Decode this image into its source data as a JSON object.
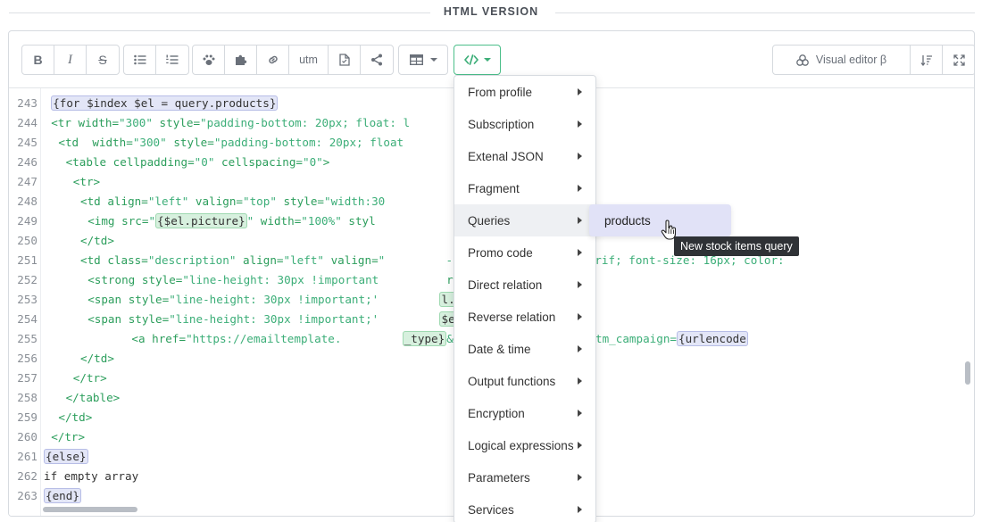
{
  "header": {
    "title": "HTML VERSION"
  },
  "toolbar": {
    "bold_label": "B",
    "italic_label": "I",
    "strike_label": "S",
    "utm_label": "utm",
    "visual_editor_label": "Visual editor β",
    "icons": [
      "bold-icon",
      "italic-icon",
      "strikethrough-icon",
      "bullet-list-icon",
      "numbered-list-icon",
      "paw-icon",
      "puzzle-icon",
      "link-icon",
      "utm-text",
      "document-icon",
      "share-icon",
      "table-icon",
      "code-icon",
      "sort-icon",
      "expand-icon"
    ]
  },
  "code_lines": [
    {
      "n": "243",
      "i": 1,
      "parts": [
        [
          "tpl",
          "{for $index $el = query.products}"
        ]
      ]
    },
    {
      "n": "244",
      "i": 1,
      "parts": [
        [
          "tag",
          "<tr "
        ],
        [
          "attr",
          "width="
        ],
        [
          "str",
          "\"300\""
        ],
        [
          "attr",
          " style="
        ],
        [
          "str",
          "\"padding-bottom: 20px; float: l"
        ]
      ]
    },
    {
      "n": "245",
      "i": 2,
      "parts": [
        [
          "tag",
          "<td  "
        ],
        [
          "attr",
          "width="
        ],
        [
          "str",
          "\"300\""
        ],
        [
          "attr",
          " style="
        ],
        [
          "str",
          "\"padding-bottom: 20px; float"
        ]
      ]
    },
    {
      "n": "246",
      "i": 3,
      "parts": [
        [
          "tag",
          "<table "
        ],
        [
          "attr",
          "cellpadding="
        ],
        [
          "str",
          "\"0\""
        ],
        [
          "attr",
          " cellspacing="
        ],
        [
          "str",
          "\"0\""
        ],
        [
          "tag",
          ">"
        ]
      ]
    },
    {
      "n": "247",
      "i": 4,
      "parts": [
        [
          "tag",
          "<tr>"
        ]
      ]
    },
    {
      "n": "248",
      "i": 5,
      "parts": [
        [
          "tag",
          "<td "
        ],
        [
          "attr",
          "align="
        ],
        [
          "str",
          "\"left\""
        ],
        [
          "attr",
          " valign="
        ],
        [
          "str",
          "\"top\""
        ],
        [
          "attr",
          " style="
        ],
        [
          "str",
          "\"width:30"
        ]
      ]
    },
    {
      "n": "249",
      "i": 6,
      "parts": [
        [
          "tag",
          "<img "
        ],
        [
          "attr",
          "src="
        ],
        [
          "str",
          "\""
        ],
        [
          "tplg",
          "{$el.picture}"
        ],
        [
          "str",
          "\""
        ],
        [
          "attr",
          " width="
        ],
        [
          "str",
          "\"100%\""
        ],
        [
          "attr",
          " styl"
        ],
        [
          "plain",
          "                          "
        ],
        [
          "tag",
          "nter>"
        ]
      ]
    },
    {
      "n": "250",
      "i": 5,
      "parts": [
        [
          "tag",
          "</td>"
        ]
      ]
    },
    {
      "n": "251",
      "i": 5,
      "parts": [
        [
          "tag",
          "<td "
        ],
        [
          "attr",
          "class="
        ],
        [
          "str",
          "\"description\""
        ],
        [
          "attr",
          " align="
        ],
        [
          "str",
          "\"left\""
        ],
        [
          "attr",
          " valign="
        ],
        [
          "str",
          "\""
        ],
        [
          "plain",
          "         "
        ],
        [
          "str",
          "-family: arial,sans-serif; font-size: 16px; color:"
        ]
      ]
    },
    {
      "n": "252",
      "i": 6,
      "parts": [
        [
          "tag",
          "<strong "
        ],
        [
          "attr",
          "style="
        ],
        [
          "str",
          "\"line-height: 30px !important"
        ],
        [
          "plain",
          "          "
        ],
        [
          "tag",
          "rong> <br>"
        ]
      ]
    },
    {
      "n": "253",
      "i": 6,
      "parts": [
        [
          "tag",
          "<span "
        ],
        [
          "attr",
          "style="
        ],
        [
          "str",
          "\"line-height: 30px !important;'"
        ],
        [
          "plain",
          "         "
        ],
        [
          "tplg",
          "l.model}"
        ],
        [
          "tag",
          "<br>"
        ]
      ]
    },
    {
      "n": "254",
      "i": 6,
      "parts": [
        [
          "tag",
          "<span "
        ],
        [
          "attr",
          "style="
        ],
        [
          "str",
          "\"line-height: 30px !important;'"
        ],
        [
          "plain",
          "         "
        ],
        [
          "tplg",
          "$el.price}"
        ],
        [
          "plain",
          " "
        ],
        [
          "tag",
          "<br>"
        ]
      ]
    },
    {
      "n": "255",
      "i": 12,
      "parts": [
        [
          "tag",
          "<a "
        ],
        [
          "attr",
          "href="
        ],
        [
          "str",
          "\"https://emailtemplate."
        ],
        [
          "plain",
          "         "
        ],
        [
          "tplg",
          "_type}"
        ],
        [
          "str",
          "&utm_medium=altkraft&utm_campaign="
        ],
        [
          "tpl",
          "{urlencode"
        ]
      ]
    },
    {
      "n": "256",
      "i": 5,
      "parts": [
        [
          "tag",
          "</td>"
        ]
      ]
    },
    {
      "n": "257",
      "i": 4,
      "parts": [
        [
          "tag",
          "</tr>"
        ]
      ]
    },
    {
      "n": "258",
      "i": 3,
      "parts": [
        [
          "tag",
          "</table>"
        ]
      ]
    },
    {
      "n": "259",
      "i": 2,
      "parts": [
        [
          "tag",
          "</td>"
        ]
      ]
    },
    {
      "n": "260",
      "i": 1,
      "parts": [
        [
          "tag",
          "</tr>"
        ]
      ]
    },
    {
      "n": "261",
      "i": 0,
      "parts": [
        [
          "tpl",
          "{else}"
        ]
      ]
    },
    {
      "n": "262",
      "i": 0,
      "parts": [
        [
          "plain",
          "if empty array"
        ]
      ]
    },
    {
      "n": "263",
      "i": 0,
      "parts": [
        [
          "tpl",
          "{end}"
        ]
      ]
    }
  ],
  "menu": {
    "items": [
      {
        "label": "From profile"
      },
      {
        "label": "Subscription"
      },
      {
        "label": "Extenal JSON"
      },
      {
        "label": "Fragment"
      },
      {
        "label": "Queries",
        "active": true
      },
      {
        "label": "Promo code"
      },
      {
        "label": "Direct relation"
      },
      {
        "label": "Reverse relation"
      },
      {
        "label": "Date & time"
      },
      {
        "label": "Output functions"
      },
      {
        "label": "Encryption"
      },
      {
        "label": "Logical expressions"
      },
      {
        "label": "Parameters"
      },
      {
        "label": "Services"
      }
    ],
    "submenu_item": "products",
    "tooltip": "New stock items query"
  },
  "colors": {
    "accent_green": "#3cae78",
    "template_tag_bg": "#e3e6f7",
    "submenu_bg": "#e1e2f7"
  }
}
